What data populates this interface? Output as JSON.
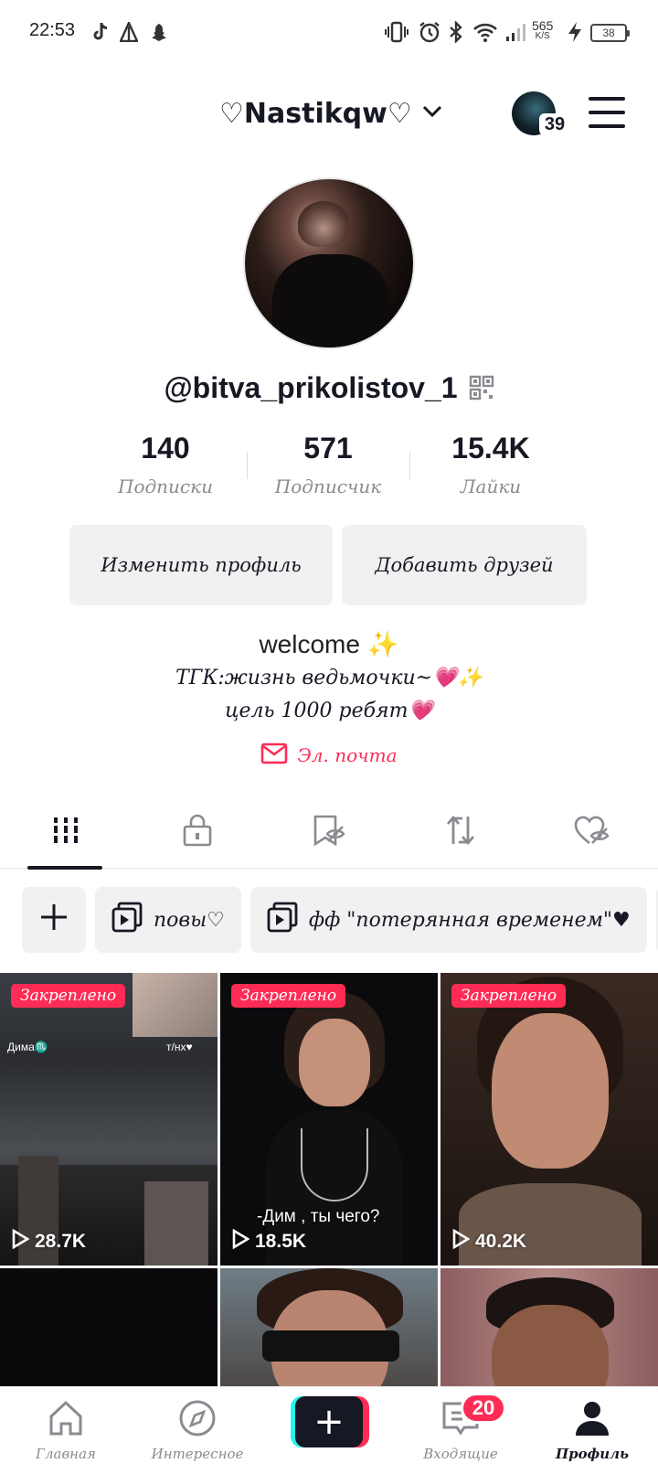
{
  "status_bar": {
    "time": "22:53",
    "net_speed_value": "565",
    "net_speed_unit": "K/S",
    "battery": "38",
    "icons": [
      "tiktok-icon",
      "alert-icon",
      "snapchat-icon",
      "vibrate-icon",
      "alarm-icon",
      "bluetooth-icon",
      "wifi-icon",
      "signal-icon",
      "charging-icon"
    ]
  },
  "header": {
    "nickname": "♡Nastikqw♡",
    "story_count": "39",
    "icons": [
      "chevron-down-icon",
      "menu-icon"
    ]
  },
  "profile": {
    "handle": "@bitva_prikolistov_1",
    "stats": [
      {
        "value": "140",
        "label": "Подписки"
      },
      {
        "value": "571",
        "label": "Подписчик"
      },
      {
        "value": "15.4K",
        "label": "Лайки"
      }
    ],
    "edit_button": "Изменить профиль",
    "add_friends_button": "Добавить друзей",
    "bio_line1": "welcome ✨",
    "bio_line2": "ТГК:жизнь ведьмочки~💗✨",
    "bio_line3": "цель 1000 ребят💗",
    "email_label": "Эл. почта"
  },
  "tabs": [
    {
      "icon": "grid-icon",
      "active": true
    },
    {
      "icon": "lock-icon",
      "active": false
    },
    {
      "icon": "bookmark-icon",
      "active": false
    },
    {
      "icon": "repost-icon",
      "active": false
    },
    {
      "icon": "hidden-like-icon",
      "active": false
    }
  ],
  "playlists": [
    {
      "name": "повы♡"
    },
    {
      "name": "фф \"потерянная временем\"♥"
    }
  ],
  "videos": [
    {
      "pinned": true,
      "pinned_label": "Закреплено",
      "views": "28.7K"
    },
    {
      "pinned": true,
      "pinned_label": "Закреплено",
      "views": "18.5K",
      "caption": "-Дим , ты чего?"
    },
    {
      "pinned": true,
      "pinned_label": "Закреплено",
      "views": "40.2K"
    }
  ],
  "thumb_text": {
    "overlay_left": "Дима♏",
    "overlay_right": "т/нх♥"
  },
  "bottom_nav": [
    {
      "label": "Главная",
      "icon": "home-icon"
    },
    {
      "label": "Интересное",
      "icon": "compass-icon"
    },
    {
      "label": "",
      "icon": "plus-icon"
    },
    {
      "label": "Входящие",
      "icon": "inbox-icon",
      "badge": "20"
    },
    {
      "label": "Профиль",
      "icon": "profile-icon",
      "active": true
    }
  ],
  "colors": {
    "accent": "#fe2c55",
    "text": "#161823",
    "muted": "#8a8b91",
    "chip_bg": "#f1f1f2",
    "cyan": "#25f4ee"
  }
}
